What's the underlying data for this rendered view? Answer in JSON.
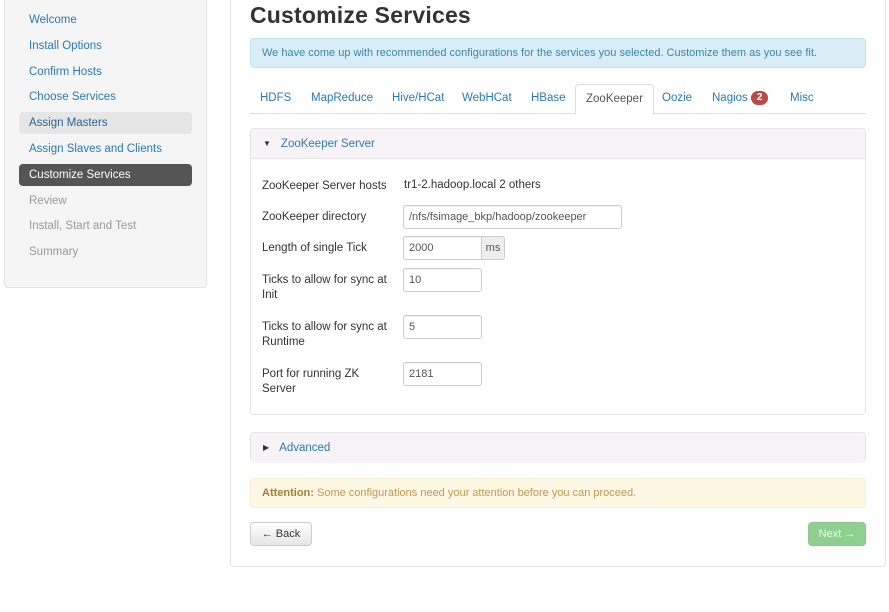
{
  "sidebar": {
    "items": [
      {
        "label": "Welcome",
        "state": "done"
      },
      {
        "label": "Install Options",
        "state": "done"
      },
      {
        "label": "Confirm Hosts",
        "state": "done"
      },
      {
        "label": "Choose Services",
        "state": "done"
      },
      {
        "label": "Assign Masters",
        "state": "highlighted"
      },
      {
        "label": "Assign Slaves and Clients",
        "state": "done"
      },
      {
        "label": "Customize Services",
        "state": "active"
      },
      {
        "label": "Review",
        "state": "disabled"
      },
      {
        "label": "Install, Start and Test",
        "state": "disabled"
      },
      {
        "label": "Summary",
        "state": "disabled"
      }
    ]
  },
  "main": {
    "title": "Customize Services",
    "info_text": "We have come up with recommended configurations for the services you selected. Customize them as you see fit.",
    "tabs": [
      {
        "label": "HDFS"
      },
      {
        "label": "MapReduce"
      },
      {
        "label": "Hive/HCat"
      },
      {
        "label": "WebHCat"
      },
      {
        "label": "HBase"
      },
      {
        "label": "ZooKeeper",
        "active": true
      },
      {
        "label": "Oozie"
      },
      {
        "label": "Nagios",
        "badge": "2"
      },
      {
        "label": "Misc"
      }
    ],
    "zk_section": {
      "title": "ZooKeeper Server",
      "hosts_label": "ZooKeeper Server hosts",
      "hosts_value": "tr1-2.hadoop.local 2 others",
      "dir_label": "ZooKeeper directory",
      "dir_value": "/nfs/fsimage_bkp/hadoop/zookeeper",
      "tick_label": "Length of single Tick",
      "tick_value": "2000",
      "tick_unit": "ms",
      "init_label_1": "Ticks to allow for sync at",
      "init_label_2": "Init",
      "init_value": "10",
      "runtime_label_1": "Ticks to allow for sync at",
      "runtime_label_2": "Runtime",
      "runtime_value": "5",
      "port_label_1": "Port for running ZK",
      "port_label_2": "Server",
      "port_value": "2181"
    },
    "advanced_title": "Advanced",
    "attention_bold": "Attention:",
    "attention_text": " Some configurations need your attention before you can proceed.",
    "back_label": "← Back",
    "next_label": "Next →"
  },
  "colors": {
    "link": "#2a7ab0",
    "active_nav": "#555555",
    "info_bg": "#d9edf7",
    "warn_bg": "#fcf8e3",
    "badge": "#b94a48",
    "next_btn": "#8fcf8f"
  },
  "icons": {
    "section_toggle_open": "caret-down-icon",
    "section_toggle_closed": "caret-right-icon"
  }
}
